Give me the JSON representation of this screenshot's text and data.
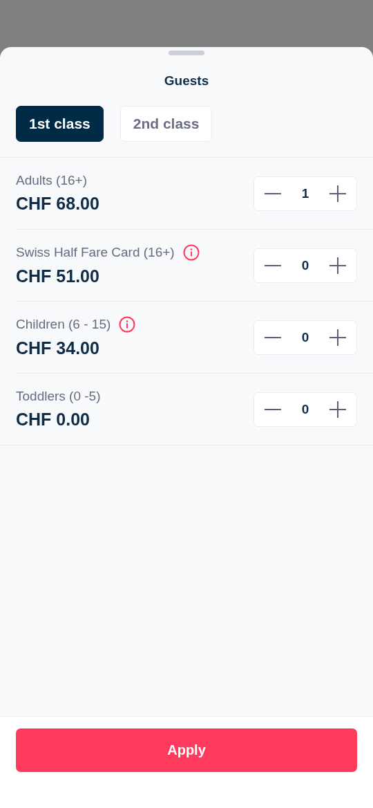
{
  "sheet": {
    "title": "Guests"
  },
  "tabs": [
    {
      "label": "1st class",
      "selected": true
    },
    {
      "label": "2nd class",
      "selected": false
    }
  ],
  "passengers": [
    {
      "label": "Adults (16+)",
      "price": "CHF 68.00",
      "count": "1",
      "info": false
    },
    {
      "label": "Swiss Half Fare Card (16+)",
      "price": "CHF 51.00",
      "count": "0",
      "info": true
    },
    {
      "label": "Children (6 - 15)",
      "price": "CHF 34.00",
      "count": "0",
      "info": true
    },
    {
      "label": "Toddlers (0 -5)",
      "price": "CHF 0.00",
      "count": "0",
      "info": false
    }
  ],
  "apply_button": {
    "label": "Apply"
  }
}
